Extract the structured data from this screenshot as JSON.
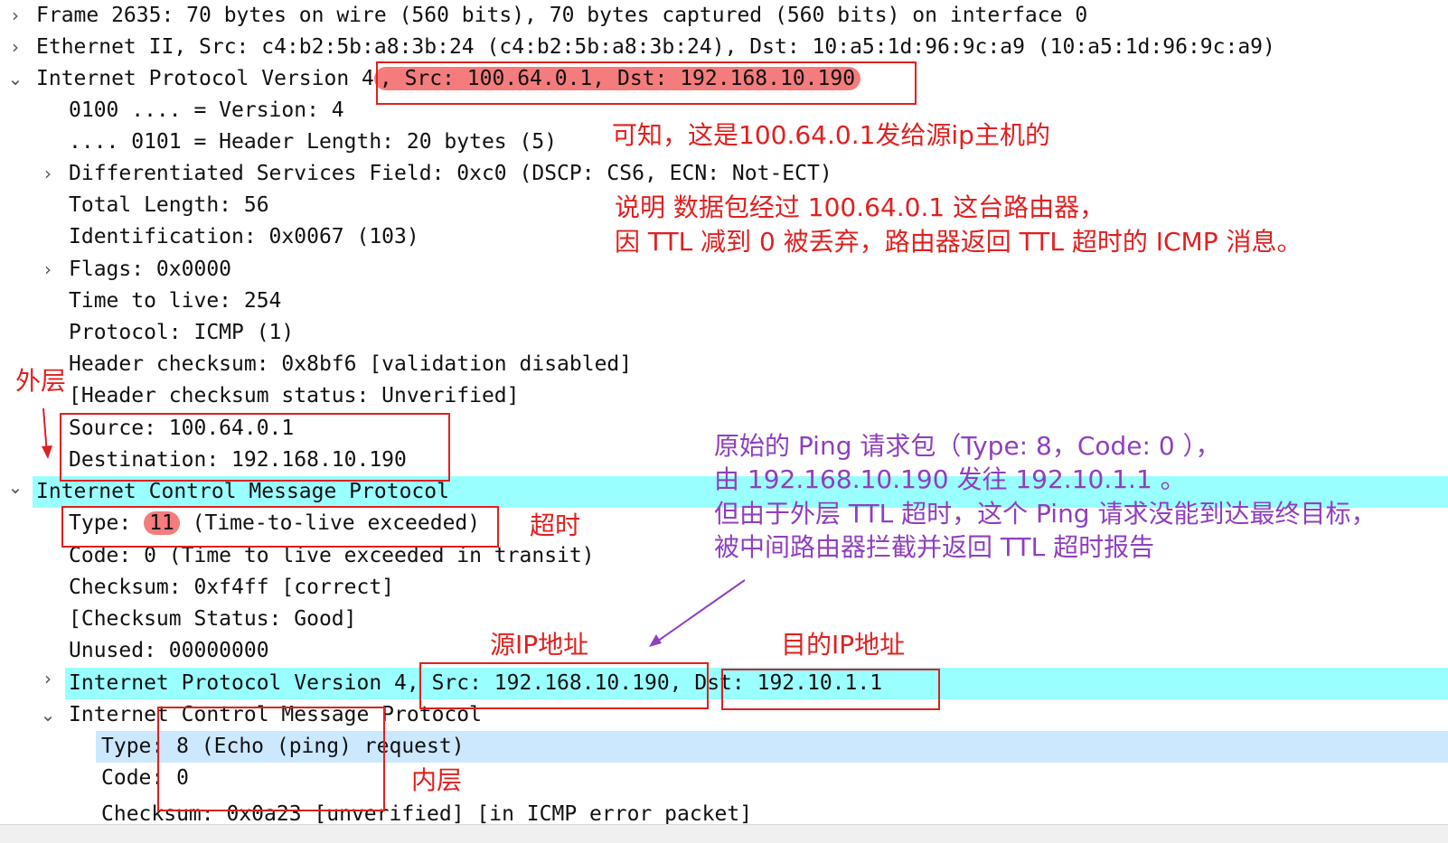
{
  "tree": {
    "frame": "Frame 2635: 70 bytes on wire (560 bits), 70 bytes captured (560 bits) on interface 0",
    "ethernet": "Ethernet II, Src: c4:b2:5b:a8:3b:24 (c4:b2:5b:a8:3b:24), Dst: 10:a5:1d:96:9c:a9 (10:a5:1d:96:9c:a9)",
    "ip_outer_prefix": "Internet Protocol Version 4",
    "ip_outer_suffix": ", Src: 100.64.0.1, Dst: 192.168.10.190",
    "version": "0100 .... = Version: 4",
    "header_length": ".... 0101 = Header Length: 20 bytes (5)",
    "dsf": "Differentiated Services Field: 0xc0 (DSCP: CS6, ECN: Not-ECT)",
    "total_length": "Total Length: 56",
    "identification": "Identification: 0x0067 (103)",
    "flags": "Flags: 0x0000",
    "ttl": "Time to live: 254",
    "protocol": "Protocol: ICMP (1)",
    "header_checksum": "Header checksum: 0x8bf6 [validation disabled]",
    "header_checksum_status": "[Header checksum status: Unverified]",
    "source": "Source: 100.64.0.1",
    "destination": "Destination: 192.168.10.190",
    "icmp_outer": "Internet Control Message Protocol",
    "type_label": "Type: ",
    "type_value": "11",
    "type_desc": " (Time-to-live exceeded)",
    "code": "Code: 0 (Time to live exceeded in transit)",
    "checksum": "Checksum: 0xf4ff [correct]",
    "checksum_status": "[Checksum Status: Good]",
    "unused": "Unused: 00000000",
    "ip_inner": "Internet Protocol Version 4, Src: 192.168.10.190, Dst: 192.10.1.1",
    "icmp_inner": "Internet Control Message Protocol",
    "inner_type": "Type: 8 (Echo (ping) request)",
    "inner_code": "Code: 0",
    "inner_checksum": "Checksum: 0x0a23 [unverified] [in ICMP error packet]"
  },
  "annotations": {
    "note1": "可知，这是100.64.0.1发给源ip主机的",
    "note2_line1": "说明 数据包经过 100.64.0.1 这台路由器，",
    "note2_line2": "因 TTL 减到 0 被丢弃，路由器返回 TTL 超时的 ICMP 消息。",
    "outer_label": "外层",
    "timeout_label": "超时",
    "purple_line1": "原始的 Ping 请求包（Type: 8，Code: 0 ），",
    "purple_line2": "由 192.168.10.190 发往 192.10.1.1 。",
    "purple_line3": "但由于外层 TTL 超时，这个 Ping 请求没能到达最终目标，",
    "purple_line4": "被中间路由器拦截并返回 TTL 超时报告",
    "src_ip_label": "源IP地址",
    "dst_ip_label": "目的IP地址",
    "inner_label": "内层"
  },
  "colors": {
    "highlight_row": "#99ffff",
    "selected_row": "#cce8ff",
    "annotation_red": "#e02020",
    "annotation_purple": "#8f3fbf",
    "pill": "#f47c7c"
  }
}
